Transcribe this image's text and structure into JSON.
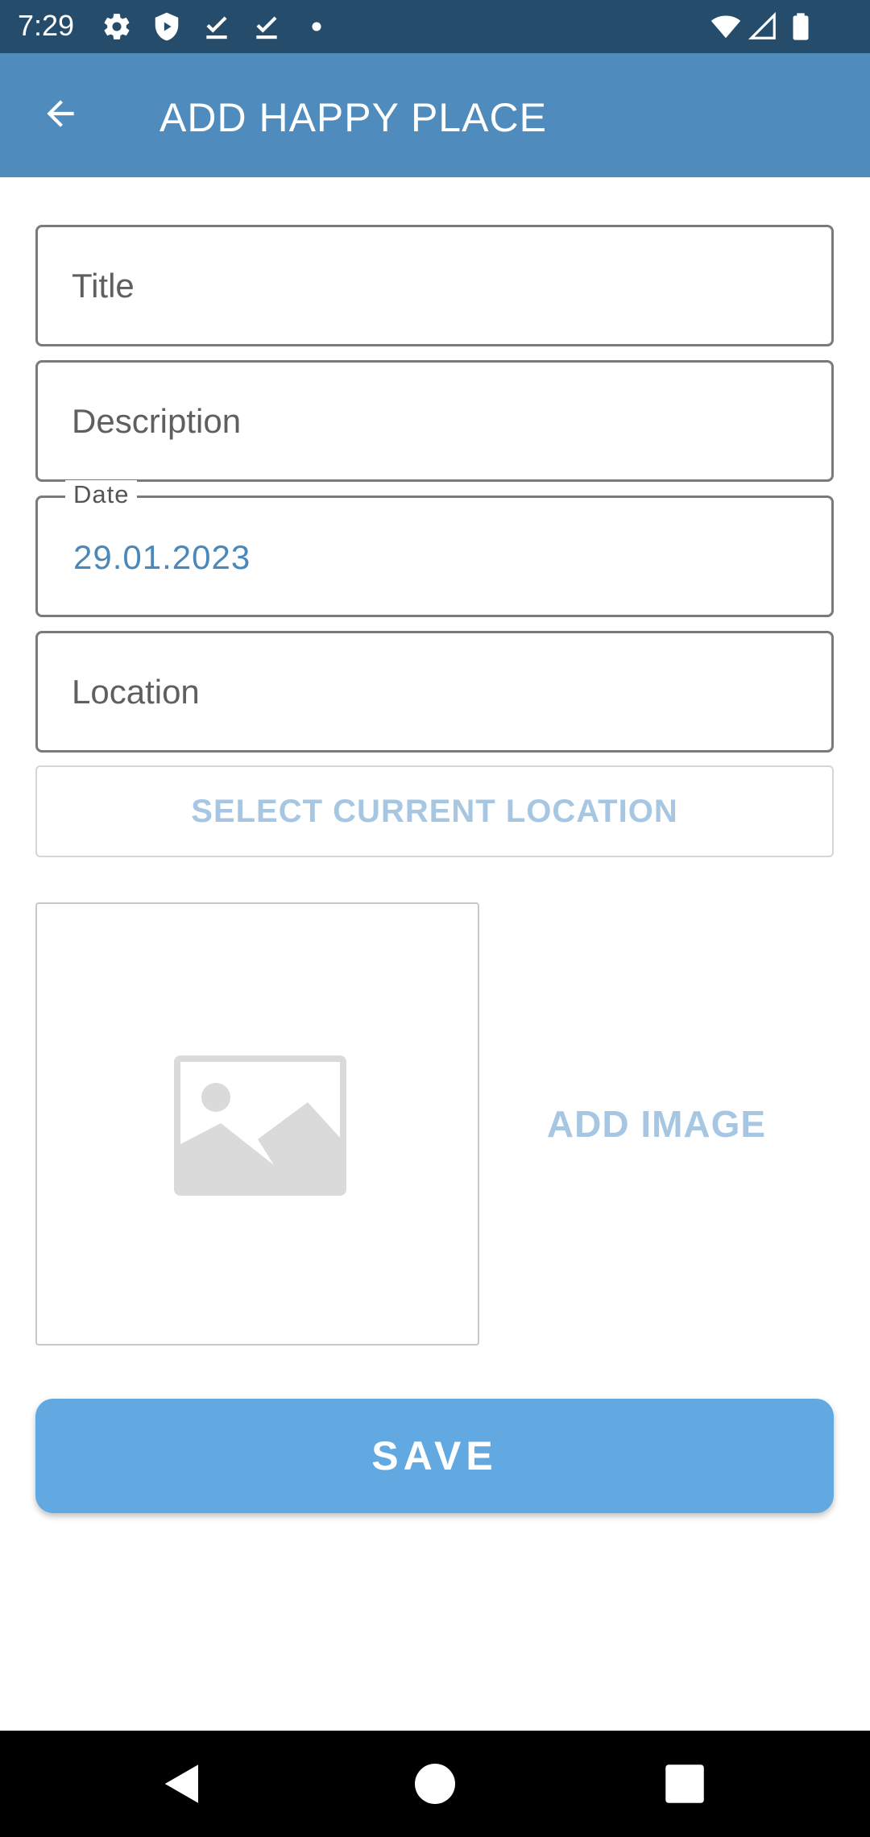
{
  "status_bar": {
    "time": "7:29",
    "left_icons": [
      "gear-icon",
      "shield-icon",
      "download-done-icon",
      "download-done-icon",
      "dot-icon"
    ],
    "right_icons": [
      "wifi-icon",
      "signal-icon",
      "battery-icon"
    ],
    "background": "#264c6b"
  },
  "app_bar": {
    "title": "ADD HAPPY PLACE",
    "back_icon": "arrow-back-icon",
    "background": "#4f8cbd"
  },
  "form": {
    "title_placeholder": "Title",
    "description_placeholder": "Description",
    "date_label": "Date",
    "date_value": "29.01.2023",
    "location_placeholder": "Location",
    "select_location_label": "SELECT CURRENT LOCATION",
    "image_placeholder_icon": "image-placeholder-icon",
    "add_image_label": "ADD IMAGE",
    "save_label": "SAVE"
  },
  "nav_bar": {
    "buttons": [
      "back-triangle-icon",
      "home-circle-icon",
      "recents-square-icon"
    ]
  },
  "colors": {
    "accent": "#4a88bb",
    "save_button": "#62a9e2",
    "disabled_text": "#a6c6e2"
  }
}
